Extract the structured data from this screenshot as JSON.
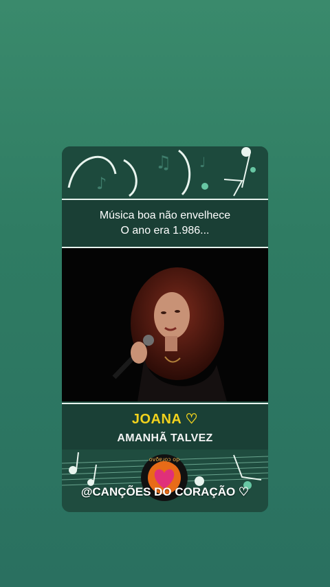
{
  "caption": {
    "line1": "Música boa não envelhece",
    "line2": "O ano era 1.986..."
  },
  "song": {
    "artist": "JOANA ♡",
    "title": "AMANHÃ TALVEZ"
  },
  "handle": "@CANÇÕES DO CORAÇÃO ♡",
  "logo_text": "ovðɐɹoɔ op",
  "colors": {
    "background": "#2f7c63",
    "card": "#1f4c3f",
    "artist": "#f2d21d"
  },
  "icons": [
    "music-notes-decoration",
    "microphone-icon",
    "heart-logo-icon"
  ]
}
